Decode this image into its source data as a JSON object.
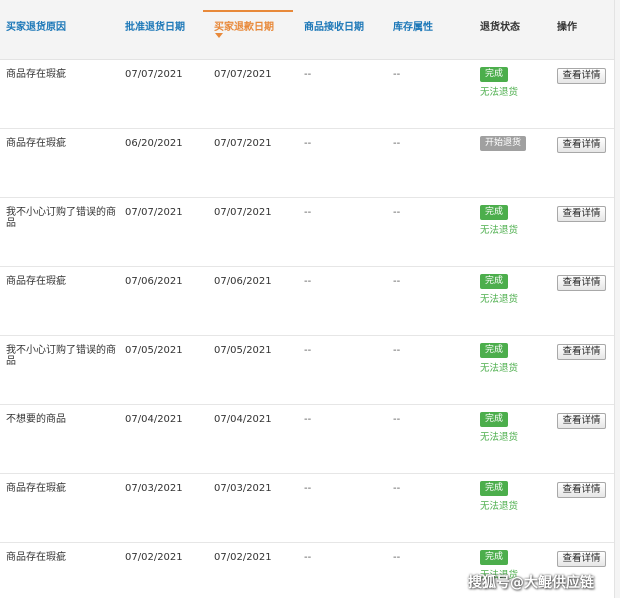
{
  "header": {
    "col_reason": "买家退货原因",
    "col_approve": "批准退货日期",
    "col_refund": "买家退款日期",
    "col_receive": "商品接收日期",
    "col_stock": "库存属性",
    "col_status": "退货状态",
    "col_action": "操作"
  },
  "rows": [
    {
      "reason": "商品存在瑕疵",
      "approve": "07/07/2021",
      "refund": "07/07/2021",
      "receive": "--",
      "stock": "--",
      "status": "完成",
      "status_color": "green",
      "sub": "无法退货",
      "action": "查看详情"
    },
    {
      "reason": "商品存在瑕疵",
      "approve": "06/20/2021",
      "refund": "07/07/2021",
      "receive": "--",
      "stock": "--",
      "status": "开始退货",
      "status_color": "gray",
      "sub": "",
      "action": "查看详情"
    },
    {
      "reason": "我不小心订购了错误的商品",
      "approve": "07/07/2021",
      "refund": "07/07/2021",
      "receive": "--",
      "stock": "--",
      "status": "完成",
      "status_color": "green",
      "sub": "无法退货",
      "action": "查看详情"
    },
    {
      "reason": "商品存在瑕疵",
      "approve": "07/06/2021",
      "refund": "07/06/2021",
      "receive": "--",
      "stock": "--",
      "status": "完成",
      "status_color": "green",
      "sub": "无法退货",
      "action": "查看详情"
    },
    {
      "reason": "我不小心订购了错误的商品",
      "approve": "07/05/2021",
      "refund": "07/05/2021",
      "receive": "--",
      "stock": "--",
      "status": "完成",
      "status_color": "green",
      "sub": "无法退货",
      "action": "查看详情"
    },
    {
      "reason": "不想要的商品",
      "approve": "07/04/2021",
      "refund": "07/04/2021",
      "receive": "--",
      "stock": "--",
      "status": "完成",
      "status_color": "green",
      "sub": "无法退货",
      "action": "查看详情"
    },
    {
      "reason": "商品存在瑕疵",
      "approve": "07/03/2021",
      "refund": "07/03/2021",
      "receive": "--",
      "stock": "--",
      "status": "完成",
      "status_color": "green",
      "sub": "无法退货",
      "action": "查看详情"
    },
    {
      "reason": "商品存在瑕疵",
      "approve": "07/02/2021",
      "refund": "07/02/2021",
      "receive": "--",
      "stock": "--",
      "status": "完成",
      "status_color": "green",
      "sub": "无法退货",
      "action": "查看详情"
    }
  ],
  "watermark": "搜狐号@大鲲供应链",
  "colors": {
    "link": "#1d78b8",
    "active": "#e8893a",
    "success": "#4cae4c",
    "pending": "#a0a0a0"
  }
}
